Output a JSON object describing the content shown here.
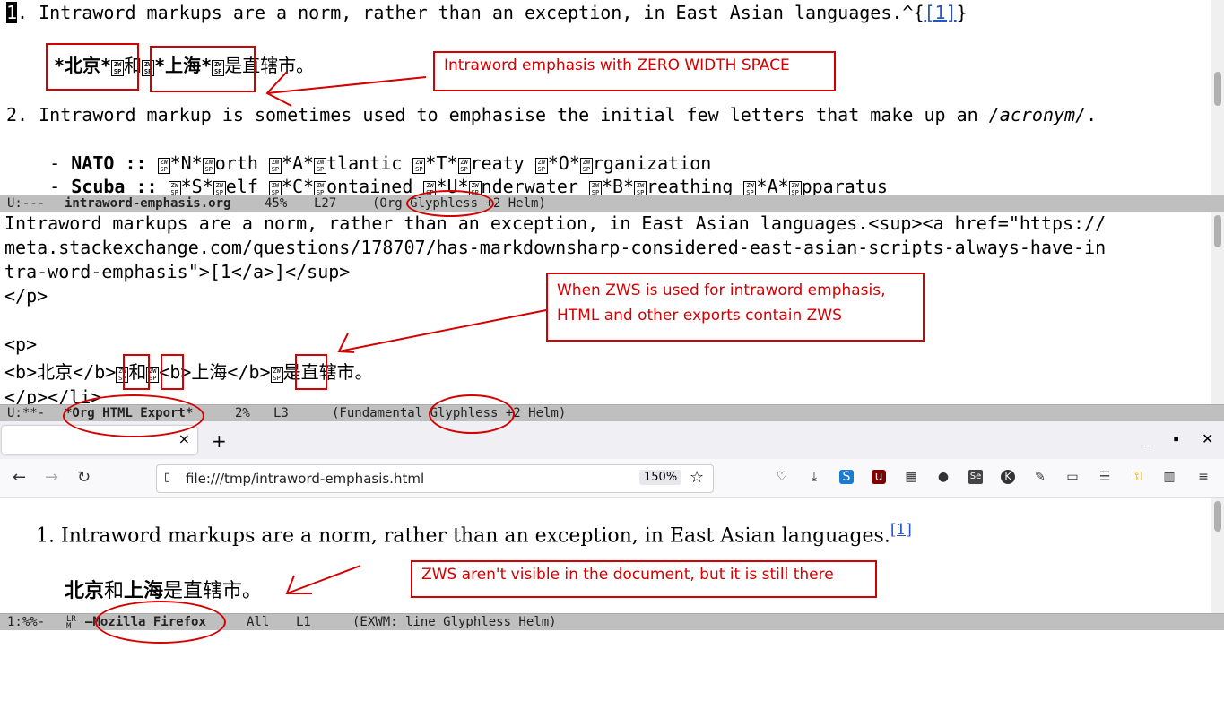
{
  "org_pane": {
    "line1": {
      "num": "1",
      "text": ". Intraword markups are a norm, rather than an exception, in East Asian languages.^{",
      "link": "[1]",
      "close": "}"
    },
    "line2": {
      "bold1": "*北京*",
      "mid": "和",
      "bold2": "*上海*",
      "tail": "是直辖市。"
    },
    "line3": {
      "prefix": "2. Intraword markup is sometimes used to emphasise the initial few letters that make up an ",
      "italic": "/acronym/",
      "suffix": "."
    },
    "line4": {
      "dash": "    - ",
      "term": "NATO ::",
      "parts": [
        "*N*",
        "orth ",
        "*A*",
        "tlantic ",
        "*T*",
        "reaty ",
        "*O*",
        "rganization"
      ]
    },
    "line5": {
      "dash": "    - ",
      "term": "Scuba ::",
      "parts": [
        "*S*",
        "elf ",
        "*C*",
        "ontained ",
        "*U*",
        "nderwater ",
        "*B*",
        "reathing ",
        "*A*",
        "pparatus"
      ]
    },
    "zws_glyph_top": "ZW",
    "zws_glyph_bottom": "SP"
  },
  "modeline1": {
    "status": "U:---",
    "buffer": "intraword-emphasis.org",
    "percent": "45%",
    "line": "L27",
    "modes": "(Org Glyphless +2 Helm)"
  },
  "html_pane": {
    "lines": [
      "Intraword markups are a norm, rather than an exception, in East Asian languages.<sup><a href=\"https://",
      "meta.stackexchange.com/questions/178707/has-markdownsharp-considered-east-asian-scripts-always-have-in",
      "tra-word-emphasis\">[1</a>]</sup>",
      "</p>",
      "",
      "<p>",
      "",
      "</p></li>"
    ],
    "line7": {
      "a": "<b>北京</b>",
      "b": "和",
      "c": "<b>上海</b>",
      "d": "是直辖市。"
    }
  },
  "modeline2": {
    "status": "U:**-",
    "buffer": "*Org HTML Export*",
    "percent": "2%",
    "line": "L3",
    "modes": "(Fundamental Glyphless +2 Helm)"
  },
  "firefox": {
    "url": "file:///tmp/intraword-emphasis.html",
    "zoom": "150%",
    "new_tab": "+",
    "close_tab": "×",
    "item1": {
      "num": "1.",
      "text": "Intraword markups are a norm, rather than an exception, in East Asian languages.",
      "sup": "[1]"
    },
    "item1b": {
      "bold1": "北京",
      "mid": "和",
      "bold2": "上海",
      "tail": "是直辖市。"
    }
  },
  "modeline3": {
    "status": "1:%%-",
    "buffer": "Mozilla Firefox",
    "percent": "All",
    "line": "L1",
    "modes": "(EXWM: line Glyphless Helm)"
  },
  "annotations": {
    "a1": "Intraword emphasis with ZERO WIDTH SPACE",
    "a2_line1": "When ZWS is used for intraword emphasis,",
    "a2_line2": "HTML and other exports contain ZWS",
    "a3": "ZWS aren't visible in the document, but it is still there"
  },
  "colors": {
    "annotation": "#d40000",
    "link": "#2554c7",
    "modeline": "#bfbfbf"
  }
}
